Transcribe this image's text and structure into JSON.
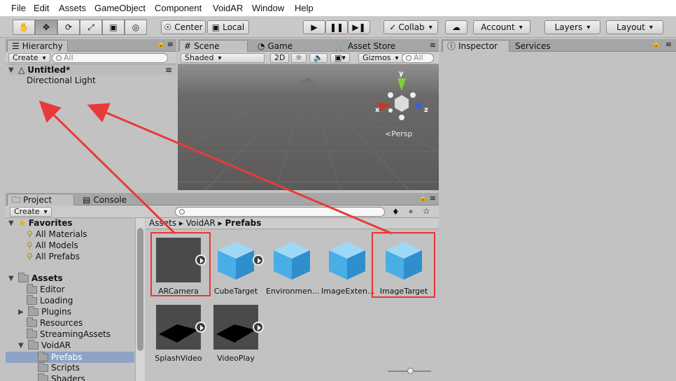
{
  "menu": [
    "File",
    "Edit",
    "Assets",
    "GameObject",
    "Component",
    "VoidAR",
    "Window",
    "Help"
  ],
  "toolbar": {
    "pivot": "Center",
    "space": "Local",
    "collab": "Collab",
    "account": "Account",
    "layers": "Layers",
    "layout": "Layout"
  },
  "hierarchy": {
    "tab": "Hierarchy",
    "create": "Create",
    "search_placeholder": "All",
    "scene": "Untitled*",
    "items": [
      "Directional Light"
    ]
  },
  "scene": {
    "tabs": [
      "Scene",
      "Game",
      "Asset Store"
    ],
    "shading": "Shaded",
    "mode2d": "2D",
    "gizmos": "Gizmos",
    "search_placeholder": "All",
    "persp": "Persp",
    "axes": {
      "x": "x",
      "y": "y",
      "z": "z"
    }
  },
  "inspector": {
    "tabs": [
      "Inspector",
      "Services"
    ]
  },
  "project": {
    "tabs": [
      "Project",
      "Console"
    ],
    "create": "Create",
    "favorites_label": "Favorites",
    "favorites": [
      "All Materials",
      "All Models",
      "All Prefabs"
    ],
    "assets_label": "Assets",
    "folders": [
      "Editor",
      "Loading",
      "Plugins",
      "Resources",
      "StreamingAssets",
      "VoidAR"
    ],
    "voidar_children": [
      "Prefabs",
      "Scripts",
      "Shaders"
    ],
    "breadcrumb": [
      "Assets",
      "VoidAR",
      "Prefabs"
    ],
    "assets": [
      "ARCamera",
      "CubeTarget",
      "Environmen...",
      "ImageExten...",
      "ImageTarget",
      "SplashVideo",
      "VideoPlay"
    ]
  },
  "colors": {
    "highlight": "#e33333",
    "cube": "#4aaee6",
    "selected_row": "#8fa3c7"
  }
}
